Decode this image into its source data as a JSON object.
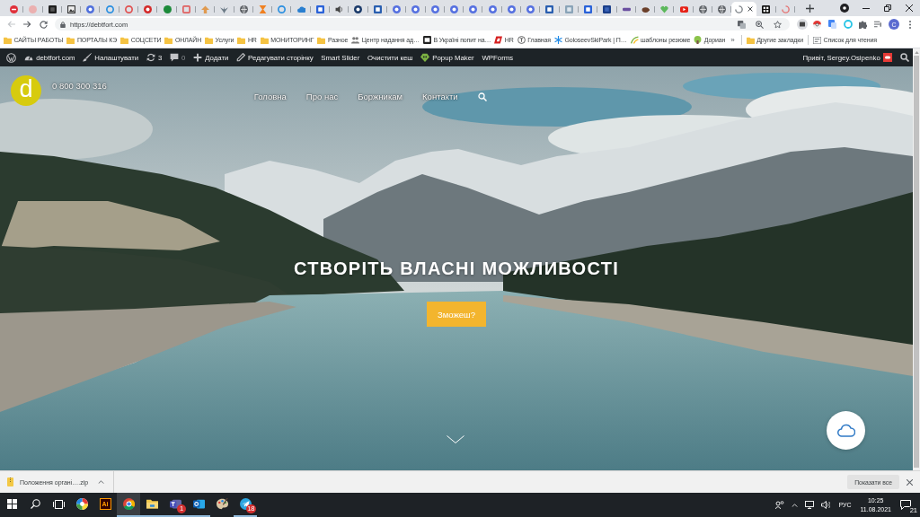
{
  "browser": {
    "tabs": [
      {
        "selected": false
      },
      {
        "selected": false
      },
      {
        "selected": false
      },
      {
        "selected": false
      },
      {
        "selected": false
      },
      {
        "selected": false
      },
      {
        "selected": false
      },
      {
        "selected": false
      },
      {
        "selected": false
      },
      {
        "selected": false
      },
      {
        "selected": false
      },
      {
        "selected": false
      },
      {
        "selected": false
      },
      {
        "selected": false
      },
      {
        "selected": false
      },
      {
        "selected": false
      },
      {
        "selected": false
      },
      {
        "selected": false
      },
      {
        "selected": false
      },
      {
        "selected": false
      },
      {
        "selected": false
      },
      {
        "selected": false
      },
      {
        "selected": false
      },
      {
        "selected": false
      },
      {
        "selected": false
      },
      {
        "selected": false
      },
      {
        "selected": false
      },
      {
        "selected": false
      },
      {
        "selected": false
      },
      {
        "selected": false
      },
      {
        "selected": false
      },
      {
        "selected": false
      },
      {
        "selected": false
      },
      {
        "selected": false
      },
      {
        "selected": false
      },
      {
        "selected": false
      },
      {
        "selected": false
      },
      {
        "selected": false
      },
      {
        "selected": true
      },
      {
        "selected": false
      },
      {
        "selected": false
      }
    ],
    "nav_buttons": [
      {
        "kind": "back",
        "disabled": true
      },
      {
        "kind": "forward",
        "disabled": false
      },
      {
        "kind": "reload",
        "disabled": false
      }
    ],
    "url": "https://debtfort.com",
    "profile_initial": "C",
    "bookmarks": [
      {
        "kind": "folder",
        "label": "САЙТЫ РАБОТЫ"
      },
      {
        "kind": "folder",
        "label": "ПОРТАЛЫ КЭ"
      },
      {
        "kind": "folder",
        "label": "СОЦСЕТИ"
      },
      {
        "kind": "folder",
        "label": "ОНЛАЙН"
      },
      {
        "kind": "folder",
        "label": "Услуги"
      },
      {
        "kind": "folder",
        "label": "HR"
      },
      {
        "kind": "folder",
        "label": "МОНИТОРИНГ"
      },
      {
        "kind": "folder",
        "label": "Разное"
      },
      {
        "kind": "site",
        "label": "Центр надання ад…"
      },
      {
        "kind": "site",
        "label": "В Україні попит на…"
      },
      {
        "kind": "site",
        "label": "HR"
      },
      {
        "kind": "site",
        "label": "Главная"
      },
      {
        "kind": "site",
        "label": "GoloseevSkiPark | П…"
      },
      {
        "kind": "site",
        "label": "шаблоны резюме"
      },
      {
        "kind": "site",
        "label": "Дориан"
      }
    ],
    "bookmarks_overflow": "»",
    "other_bookmarks": "Другие закладки",
    "reading_list": "Список для чтения"
  },
  "admin_bar": {
    "items": [
      {
        "kind": "site",
        "label": "debtfort.com"
      },
      {
        "kind": "customize",
        "label": "Налаштувати"
      },
      {
        "kind": "updates",
        "label": "3"
      },
      {
        "kind": "comments",
        "label": "0"
      },
      {
        "kind": "new",
        "label": "Додати"
      },
      {
        "kind": "edit",
        "label": "Редагувати сторінку"
      },
      {
        "kind": "plain",
        "label": "Smart Slider"
      },
      {
        "kind": "plain",
        "label": "Очистити кеш"
      },
      {
        "kind": "plugin",
        "label": "Popup Maker"
      },
      {
        "kind": "plain",
        "label": "WPForms"
      }
    ],
    "greeting": "Привіт, Sergey.Osipenko"
  },
  "site": {
    "logo_letter": "d",
    "phone": "0 800 300 316",
    "nav": [
      {
        "label": "Головна"
      },
      {
        "label": "Про нас"
      },
      {
        "label": "Боржникам"
      },
      {
        "label": "Контакти"
      }
    ],
    "hero_title": "СТВОРІТЬ ВЛАСНІ МОЖЛИВОСТІ",
    "hero_button": "Зможеш?"
  },
  "download_bar": {
    "file": "Положення органі….zip",
    "show_all": "Показати все"
  },
  "taskbar": {
    "apps": [
      {
        "kind": "wheel",
        "running": false,
        "selected": false
      },
      {
        "kind": "tile",
        "label": "Ai",
        "running": false,
        "selected": false
      },
      {
        "kind": "browser",
        "running": true,
        "selected": true
      },
      {
        "kind": "folder",
        "running": true,
        "selected": false
      },
      {
        "kind": "chat",
        "running": true,
        "selected": false,
        "badge": "1"
      },
      {
        "kind": "mail",
        "running": true,
        "selected": false
      },
      {
        "kind": "paint",
        "running": false,
        "selected": false
      },
      {
        "kind": "messenger",
        "running": true,
        "selected": false,
        "badge": "18"
      }
    ],
    "language": "РУС",
    "time": "10:25",
    "date": "11.08.2021",
    "notification_count": "21"
  }
}
